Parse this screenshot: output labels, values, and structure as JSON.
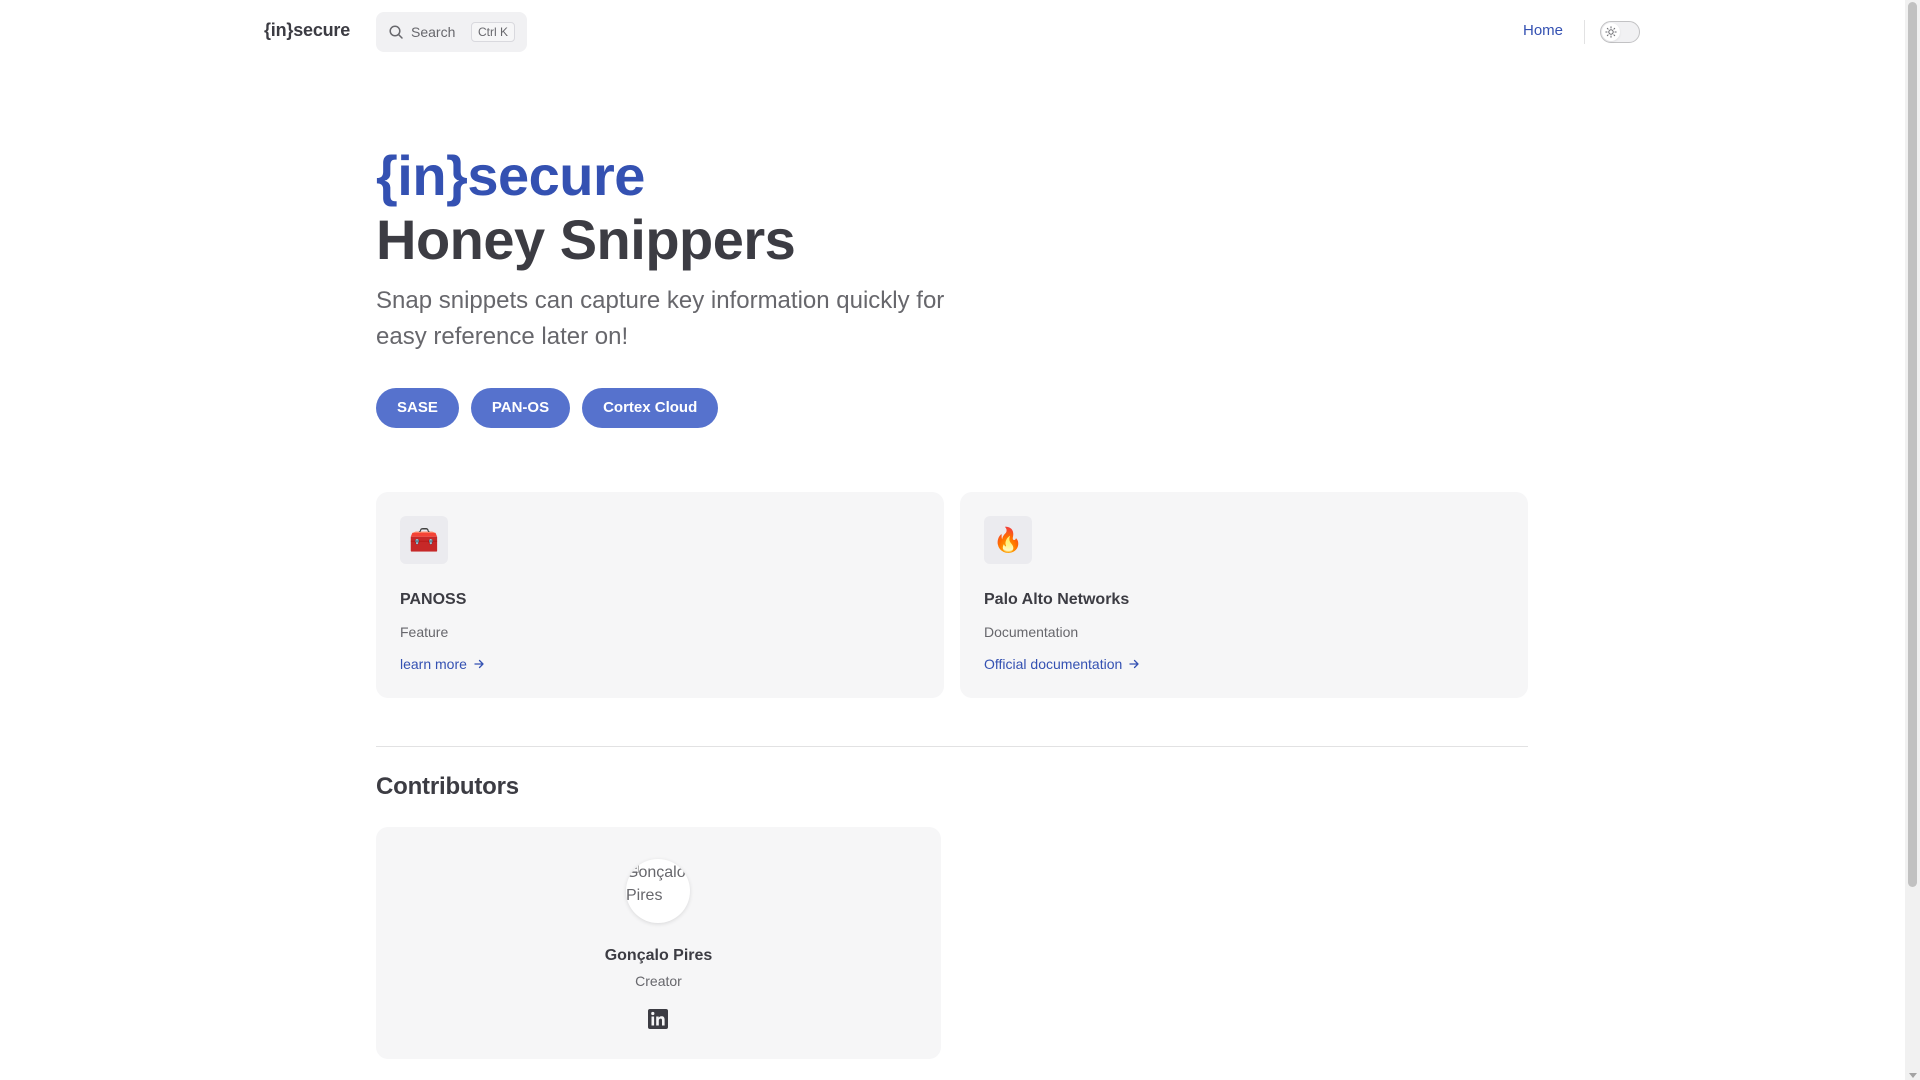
{
  "nav": {
    "brand": "{in}secure",
    "search_label": "Search",
    "search_shortcut": "Ctrl K",
    "links": [
      {
        "label": "Home"
      }
    ],
    "theme_toggle_icon": "sun-icon"
  },
  "hero": {
    "name": "{in}secure",
    "text": "Honey Snippers",
    "tagline": "Snap snippets can capture key information quickly for easy reference later on!",
    "actions": [
      {
        "label": "SASE"
      },
      {
        "label": "PAN-OS"
      },
      {
        "label": "Cortex Cloud"
      }
    ]
  },
  "features": [
    {
      "icon": "🧰",
      "icon_name": "toolbox-icon",
      "title": "PANOSS",
      "details": "Feature",
      "link": "learn more"
    },
    {
      "icon": "🔥",
      "icon_name": "fire-icon",
      "title": "Palo Alto Networks",
      "details": "Documentation",
      "link": "Official documentation"
    }
  ],
  "contributors": {
    "title": "Contributors",
    "members": [
      {
        "avatar_alt": "Gonçalo Pires",
        "name": "Gonçalo Pires",
        "title": "Creator",
        "social_icon": "linkedin-icon"
      }
    ]
  },
  "colors": {
    "brand": "#3451b2",
    "button": "#5672cd",
    "text": "#3c3c43",
    "muted": "#67676c",
    "card_bg": "#f6f6f7"
  }
}
